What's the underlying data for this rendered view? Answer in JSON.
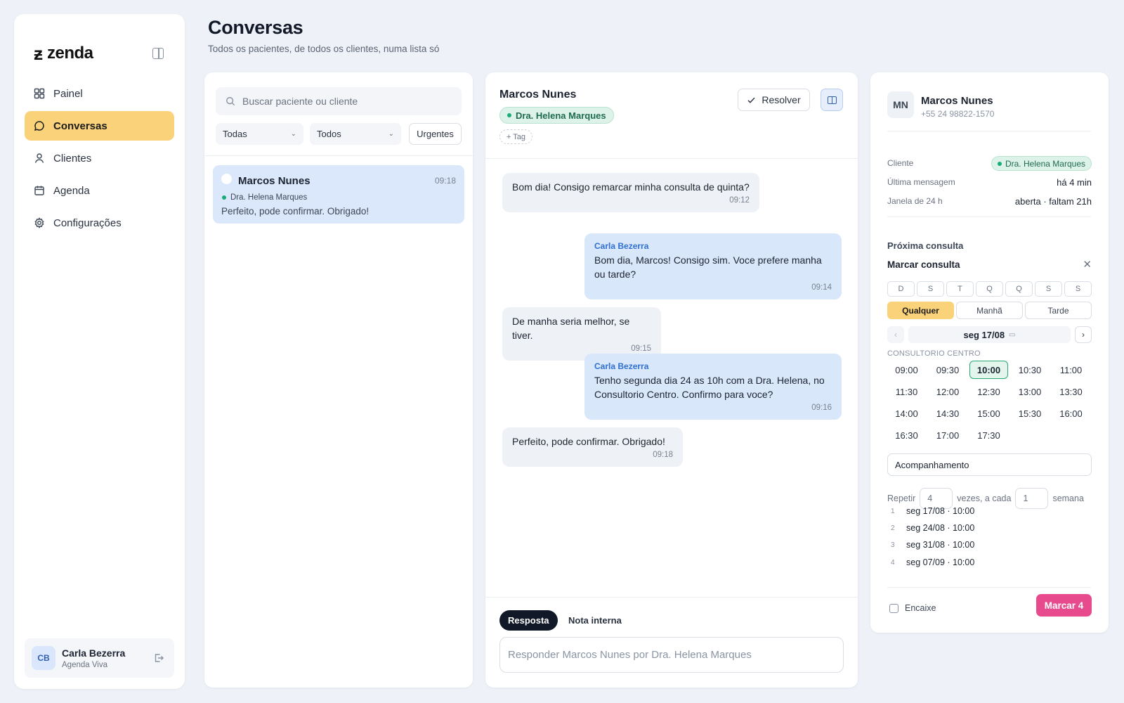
{
  "app": {
    "logo_text": "zenda"
  },
  "sidebar": {
    "items": [
      {
        "label": "Painel",
        "icon": "grid-icon"
      },
      {
        "label": "Conversas",
        "icon": "chat-bubble-icon",
        "active": true
      },
      {
        "label": "Clientes",
        "icon": "user-icon"
      },
      {
        "label": "Agenda",
        "icon": "calendar-icon"
      },
      {
        "label": "Configurações",
        "icon": "gear-icon"
      }
    ],
    "user": {
      "initials": "CB",
      "name": "Carla Bezerra",
      "org": "Agenda Viva"
    }
  },
  "header": {
    "title": "Conversas",
    "subtitle": "Todos os pacientes, de todos os clientes, numa lista só"
  },
  "list": {
    "search_placeholder": "Buscar paciente ou cliente",
    "filter_1": "Todas",
    "filter_2": "Todos",
    "urgent_label": "Urgentes",
    "conversations": [
      {
        "name": "Marcos Nunes",
        "time": "09:18",
        "client": "Dra. Helena Marques",
        "preview": "Perfeito, pode confirmar. Obrigado!"
      }
    ]
  },
  "chat": {
    "name": "Marcos Nunes",
    "client": "Dra. Helena Marques",
    "tag_label": "+ Tag",
    "resolve_label": "Resolver",
    "messages": [
      {
        "dir": "in",
        "text": "Bom dia! Consigo remarcar minha consulta de quinta?",
        "time": "09:12"
      },
      {
        "dir": "out",
        "sender": "Carla Bezerra",
        "text": "Bom dia, Marcos! Consigo sim. Voce prefere manha ou tarde?",
        "time": "09:14"
      },
      {
        "dir": "in",
        "text": "De manha seria melhor, se tiver.",
        "time": "09:15"
      },
      {
        "dir": "out",
        "sender": "Carla Bezerra",
        "text": "Tenho segunda dia 24 as 10h com a Dra. Helena, no Consultorio Centro. Confirmo para voce?",
        "time": "09:16"
      },
      {
        "dir": "in",
        "text": "Perfeito, pode confirmar. Obrigado!",
        "time": "09:18"
      }
    ],
    "tab_reply": "Resposta",
    "tab_note": "Nota interna",
    "reply_placeholder": "Responder Marcos Nunes por Dra. Helena Marques"
  },
  "contact": {
    "initials": "MN",
    "name": "Marcos Nunes",
    "phone": "+55 24 98822-1570",
    "client_label": "Cliente",
    "client_value": "Dra. Helena Marques",
    "last_msg_label": "Última mensagem",
    "last_msg_value": "há 4 min",
    "window_label": "Janela de 24 h",
    "window_value": "aberta · faltam 21h",
    "next_label": "Próxima consulta",
    "booking": {
      "title": "Marcar consulta",
      "weekdays": [
        "D",
        "S",
        "T",
        "Q",
        "Q",
        "S",
        "S"
      ],
      "periods": [
        "Qualquer",
        "Manhã",
        "Tarde"
      ],
      "active_period": "Qualquer",
      "date": "seg 17/08",
      "location": "CONSULTORIO CENTRO",
      "slots": [
        "09:00",
        "09:30",
        "10:00",
        "10:30",
        "11:00",
        "11:30",
        "12:00",
        "12:30",
        "13:00",
        "13:30",
        "14:00",
        "14:30",
        "15:00",
        "15:30",
        "16:00",
        "16:30",
        "17:00",
        "17:30"
      ],
      "selected_slot": "10:00",
      "type": "Acompanhamento",
      "repeat_label": "Repetir",
      "repeat_count": "4",
      "times_label": "vezes, a cada",
      "interval": "1",
      "unit_label": "semana",
      "occurrences": [
        {
          "idx": "1",
          "text": "seg 17/08 · 10:00"
        },
        {
          "idx": "2",
          "text": "seg 24/08 · 10:00"
        },
        {
          "idx": "3",
          "text": "seg 31/08 · 10:00"
        },
        {
          "idx": "4",
          "text": "seg 07/09 · 10:00"
        }
      ],
      "encaixe_label": "Encaixe",
      "submit_label": "Marcar 4"
    }
  },
  "colors": {
    "accent_yellow": "#fad27a",
    "accent_pink": "#e84a8e",
    "accent_green": "#1aab7a",
    "bubble_out": "#d9e7fb"
  }
}
